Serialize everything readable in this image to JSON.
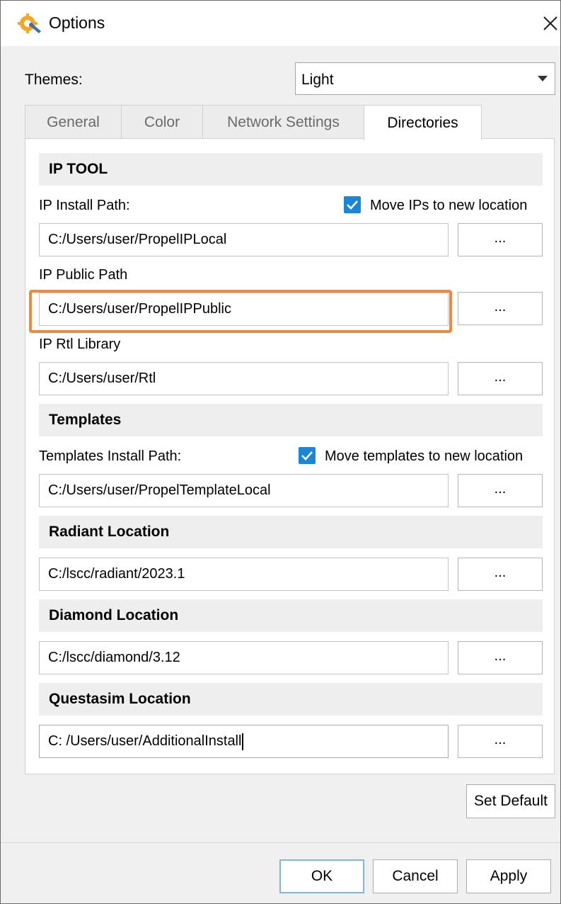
{
  "window": {
    "title": "Options",
    "app_icon": "gear-wrench-icon",
    "close_icon": "close-icon"
  },
  "themes": {
    "label": "Themes:",
    "selected": "Light"
  },
  "tabs": [
    {
      "label": "General",
      "active": false
    },
    {
      "label": "Color",
      "active": false
    },
    {
      "label": "Network Settings",
      "active": false
    },
    {
      "label": "Directories",
      "active": true
    }
  ],
  "ip_tool": {
    "header": "IP TOOL",
    "install_path_label": "IP Install Path:",
    "move_ips_label": "Move IPs to new location",
    "move_ips_checked": true,
    "install_path_value": "C:/Users/user/PropelIPLocal",
    "public_path_label": "IP Public Path",
    "public_path_value": "C:/Users/user/PropelIPPublic",
    "rtl_library_label": "IP Rtl Library",
    "rtl_library_value": "C:/Users/user/Rtl"
  },
  "templates": {
    "header": "Templates",
    "install_path_label": "Templates Install Path:",
    "move_templates_label": "Move templates to new location",
    "move_templates_checked": true,
    "install_path_value": "C:/Users/user/PropelTemplateLocal"
  },
  "radiant": {
    "header": "Radiant Location",
    "value": "C:/lscc/radiant/2023.1"
  },
  "diamond": {
    "header": "Diamond Location",
    "value": "C:/lscc/diamond/3.12"
  },
  "questasim": {
    "header": "Questasim Location",
    "value": "C: /Users/user/AdditionalInstall"
  },
  "browse_label": "...",
  "set_default_label": "Set Default",
  "buttons": {
    "ok": "OK",
    "cancel": "Cancel",
    "apply": "Apply"
  },
  "colors": {
    "accent": "#1a86d8",
    "highlight": "#f0883e"
  }
}
